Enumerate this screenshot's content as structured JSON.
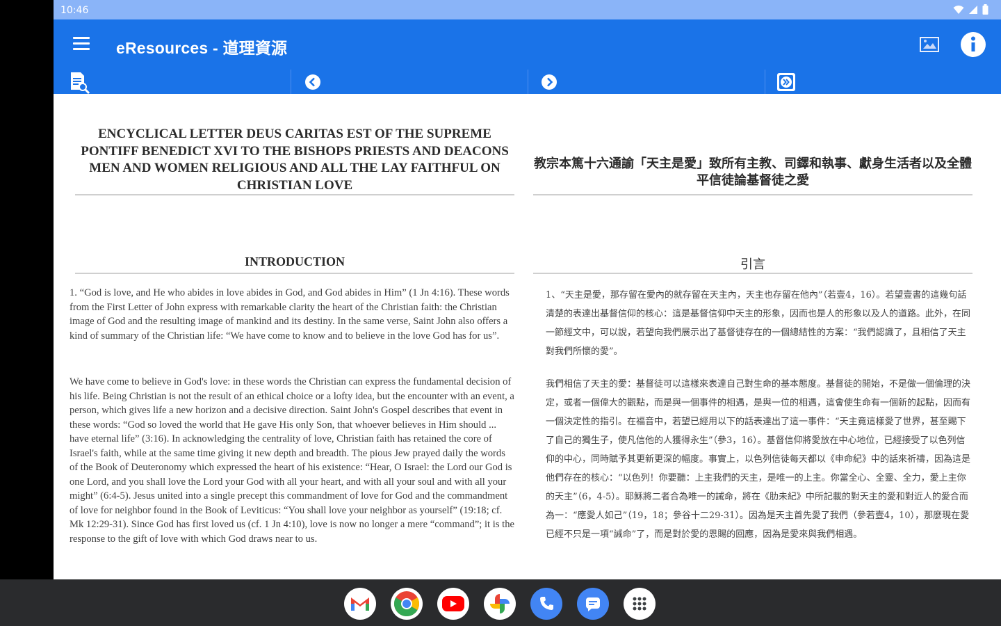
{
  "status_bar": {
    "time": "10:46"
  },
  "app_bar": {
    "title": "eResources - 道理資源"
  },
  "icons": {
    "menu": "hamburger-menu-icon",
    "screen": "screen-mode-icon",
    "info": "info-icon",
    "search_doc": "document-search-icon",
    "prev": "chevron-left-icon",
    "next": "chevron-right-icon",
    "skip": "double-chevron-right-icon"
  },
  "colors": {
    "status_bar": "#8ab4f8",
    "app_bar": "#1a73e8",
    "toolbar": "#1a73e8",
    "title_text": "#2b2b2b",
    "body_text": "#3d3d3d",
    "taskbar": "#2a2b2d"
  },
  "english": {
    "doc_title": "ENCYCLICAL LETTER DEUS CARITAS EST OF THE SUPREME PONTIFF BENEDICT XVI TO THE BISHOPS PRIESTS AND DEACONS MEN AND WOMEN RELIGIOUS AND ALL THE LAY FAITHFUL ON CHRISTIAN LOVE",
    "section": "INTRODUCTION",
    "paragraphs": [
      "1. “God is love, and He who abides in love abides in God, and God abides in Him” (1 Jn 4:16). These words from the First Letter of John express with remarkable clarity the heart of the Christian faith: the Christian image of God and the resulting image of mankind and its destiny. In the same verse, Saint John also offers a kind of summary of the Christian life: “We have come to know and to believe in the love God has for us”.",
      "We have come to believe in God's love: in these words the Christian can express the fundamental decision of his life. Being Christian is not the result of an ethical choice or a lofty idea, but the encounter with an event, a person, which gives life a new horizon and a decisive direction. Saint John's Gospel describes that event in these words: “God so loved the world that He gave His only Son, that whoever believes in Him should ... have eternal life” (3:16). In acknowledging the centrality of love, Christian faith has retained the core of Israel's faith, while at the same time giving it new depth and breadth. The pious Jew prayed daily the words of the Book of Deuteronomy which expressed the heart of his existence: “Hear, O Israel: the Lord our God is one Lord, and you shall love the Lord your God with all your heart, and with all your soul and with all your might” (6:4-5). Jesus united into a single precept this commandment of love for God and the commandment of love for neighbor found in the Book of Leviticus: “You shall love your neighbor as yourself” (19:18; cf. Mk 12:29-31). Since God has first loved us (cf. 1 Jn 4:10), love is now no longer a mere “command”; it is the response to the gift of love with which God draws near to us."
    ]
  },
  "chinese": {
    "doc_title": "教宗本篤十六通諭「天主是愛」致所有主教、司鐸和執事、獻身生活者以及全體平信徒論基督徒之愛",
    "section": "引言",
    "paragraphs": [
      "1、“天主是愛，那存留在愛內的就存留在天主內，天主也存留在他內”（若壹4，16）。若望壹書的這幾句話清楚的表達出基督信仰的核心：這是基督信仰中天主的形象，因而也是人的形象以及人的道路。此外，在同一節經文中，可以說，若望向我們展示出了基督徒存在的一個總結性的方案：“我們認識了，且相信了天主對我們所懷的愛”。",
      "我們相信了天主的愛：基督徒可以這樣來表達自己對生命的基本態度。基督徒的開始，不是做一個倫理的決定，或者一個偉大的觀點，而是與一個事件的相遇，是與一位的相遇，這會使生命有一個新的起點，因而有一個決定性的指引。在福音中，若望已經用以下的話表達出了這一事件：“天主竟這樣愛了世界，甚至賜下了自己的獨生子，使凡信他的人獲得永生”（參3，16）。基督信仰將愛放在中心地位，已經接受了以色列信仰的中心，同時賦予其更新更深的幅度。事實上，以色列信徒每天都以《申命紀》中的話來祈禱，因為這是他們存在的核心：“以色列！你要聽：上主我們的天主，是唯一的上主。你當全心、全靈、全力，愛上主你的天主”（6，4-5）。耶穌將二者合為唯一的誡命，將在《肋未紀》中所記載的對天主的愛和對近人的愛合而為一：“應愛人如己”（19，18；參谷十二29-31）。因為是天主首先愛了我們（參若壹4，10），那麼現在愛已經不只是一項“誡命”了，而是對於愛的恩賜的回應，因為是愛來與我們相遇。"
    ]
  }
}
